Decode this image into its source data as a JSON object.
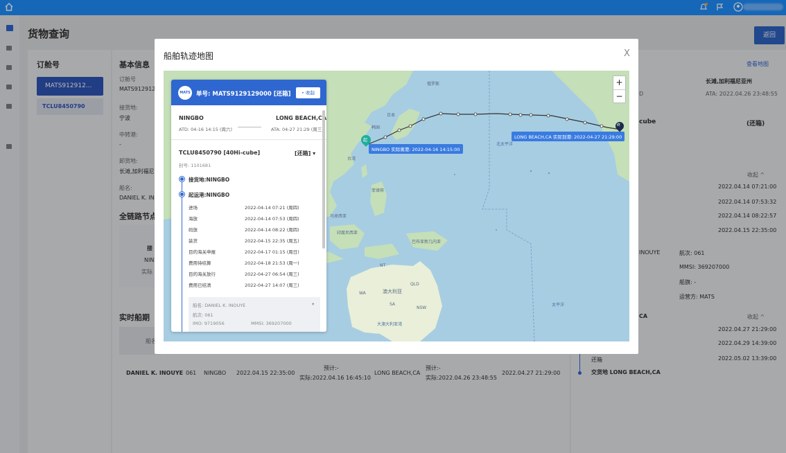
{
  "app": {
    "page_title": "货物查询",
    "back_label": "返回"
  },
  "icons": {
    "home": "home-icon",
    "bell": "bell-icon",
    "flag": "flag-icon",
    "user": "user-icon"
  },
  "bg": {
    "order_header": "订舱号",
    "order_selected": "MATS912912...",
    "container": "TCLU8450790",
    "basic_info": "基本信息",
    "order_no_label": "订舱号",
    "order_no_value": "MATS9129129",
    "receipt_label": "接货地:",
    "receipt_value": "宁波",
    "transit_label": "中转港:",
    "transit_value": "-",
    "delivery_label": "卸货地:",
    "delivery_value": "长滩,加利福尼",
    "vessel_name_label": "船名:",
    "vessel_name_value": "DANIEL K. INO",
    "chain_title": "全链路节点",
    "node1": "接",
    "node2": "NIN",
    "node3": "实际",
    "realtime_title": "实时船期",
    "rt_col": "船名",
    "row": {
      "vessel": "DANIEL K. INOUYE",
      "voyage": "061",
      "pol": "NINGBO",
      "etd": "2022.04.15 22:35:00",
      "plan1": "预计:-",
      "actual1": "实际:2022.04.16 16:45:10",
      "pod": "LONG BEACH,CA",
      "plan2": "预计:-",
      "actual2": "实际:2022.04.26 23:48:55",
      "eta": "2022.04.27 21:29:00"
    },
    "view_map": "查看地图",
    "dest_city": "长滩,加利福尼亚州",
    "ata_right": "ATA: 2022.04.26 23:48:55",
    "ata_left_frag": "D",
    "cube_frag": "cube",
    "status_right": "(还箱)",
    "collapse1": "收起 ^",
    "times1": [
      "2022.04.14 07:21:00",
      "2022.04.14 07:53:32",
      "2022.04.14 08:22:57",
      "2022.04.15 22:35:00"
    ],
    "vessel_frag": "INOUYE",
    "voyage_r": "航次: 061",
    "mmsi_r": "MMSI: 369207000",
    "callsign_r": "船旗: -",
    "operator_r": "运营方: MATS",
    "ca_frag": "CA",
    "collapse2": "收起 ^",
    "times2": [
      "2022.04.27 21:29:00",
      "2022.04.29 14:39:00",
      "2022.05.02 13:39:00"
    ],
    "return_box": "还箱",
    "delivery_final": "交货地 LONG BEACH,CA"
  },
  "modal": {
    "title": "船舶轨迹地图",
    "close": "X",
    "zoom_in": "+",
    "zoom_out": "−",
    "label_start": "NINGBO 实际离港: 2022-04-16 14:15:00",
    "label_end": "LONG BEACH,CA 实际到港: 2022-04-27 21:29:00",
    "start_pin": "起",
    "end_pin": "终",
    "geo": {
      "russia": "俄罗斯",
      "japan": "日本",
      "korea": "韩国",
      "china": "中国",
      "taiwan": "台湾",
      "philippines": "菲律宾",
      "vietnam": "越南",
      "thailand": "泰国",
      "malaysia": "马来西亚",
      "indonesia": "印度尼西亚",
      "png": "巴布亚新几内亚",
      "australia": "澳大利亚",
      "nt": "NT",
      "qld": "QLD",
      "wa": "WA",
      "sa": "SA",
      "nsw": "NSW",
      "pacific_n": "北太平洋",
      "pacific_s": "太平洋",
      "great_aus": "大澳大利亚湾"
    }
  },
  "card": {
    "logo": "MATS",
    "title": "单号: MATS9129129000 [还箱]",
    "collapse": "• 收起",
    "from": "NINGBO",
    "to": "LONG BEACH,CA",
    "atd": "ATD: 04-16 14:15 (周六)",
    "ata": "ATA: 04-27 21:29 (周三)",
    "container": "TCLU8450790 [40Hi-cube]",
    "status": "[还箱] ▾",
    "seal": "封号: 1101681",
    "receipt": "接货地:NINGBO",
    "pol": "起运港:NINGBO",
    "events": [
      {
        "name": "进场",
        "time": "2022-04-14 07:21 (周四)"
      },
      {
        "name": "海放",
        "time": "2022-04-14 07:53 (周四)"
      },
      {
        "name": "码放",
        "time": "2022-04-14 08:22 (周四)"
      },
      {
        "name": "装货",
        "time": "2022-04-15 22:35 (周五)"
      },
      {
        "name": "目的海关申报",
        "time": "2022-04-17 01:15 (周日)"
      },
      {
        "name": "费用待结算",
        "time": "2022-04-18 21:53 (周一)"
      },
      {
        "name": "目的海关放行",
        "time": "2022-04-27 06:54 (周三)"
      },
      {
        "name": "费用已结清",
        "time": "2022-04-27 14:07 (周三)"
      }
    ],
    "vessel_name": "船名: DANIEL K. INOUYE",
    "voyage": "航次: 061",
    "imo": "IMO: 9719056",
    "mmsi": "MMSI: 369207000"
  }
}
